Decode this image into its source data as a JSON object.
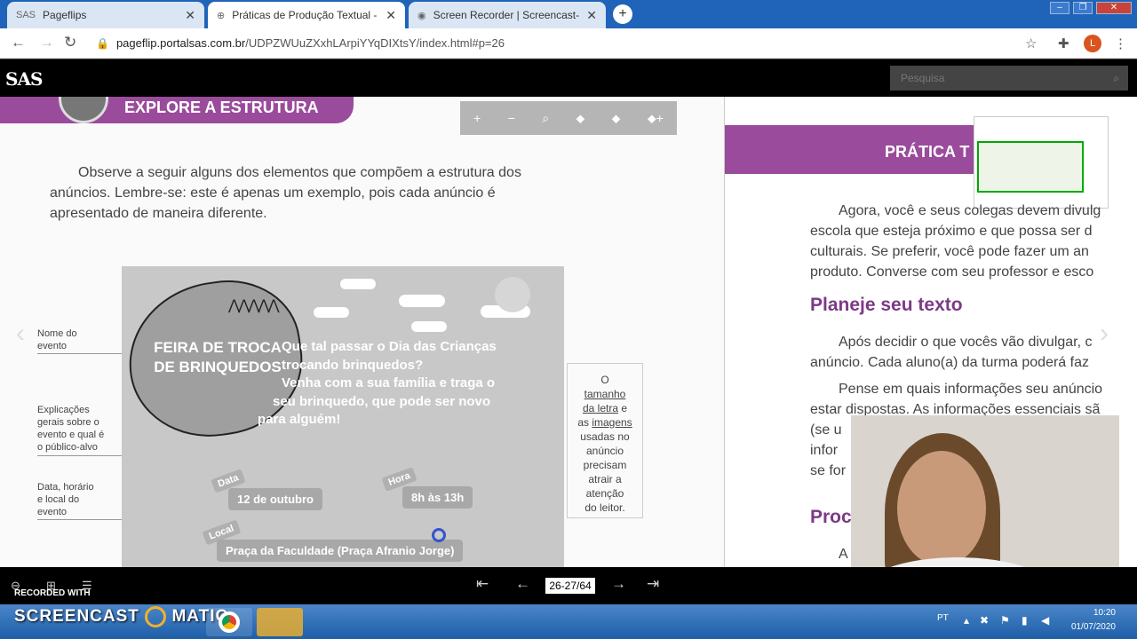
{
  "browser": {
    "tabs": [
      {
        "icon": "SAS",
        "title": "Pageflips",
        "active": false
      },
      {
        "icon": "⊕",
        "title": "Práticas de Produção Textual - Li",
        "active": true
      },
      {
        "icon": "◉",
        "title": "Screen Recorder | Screencast-O-M",
        "active": false
      }
    ],
    "new_tab": "+",
    "url_host": "pageflip.portalsas.com.br",
    "url_path": "/UDPZWUuZXxhLArpiYYqDIXtsY/index.html#p=26",
    "profile_initial": "L"
  },
  "viewer": {
    "logo": "SAS",
    "search_placeholder": "Pesquisa",
    "zoom_buttons": [
      "+",
      "−",
      "⌕",
      "⬥",
      "⬥",
      "⬥+"
    ],
    "page_indicator": "26-27/64"
  },
  "left_page": {
    "banner": "EXPLORE A ESTRUTURA",
    "intro": [
      "Observe a seguir alguns dos elementos que compõem a estrutura dos",
      "anúncios. Lembre-se: este é apenas um exemplo, pois cada anúncio é",
      "apresentado de maneira diferente."
    ],
    "labels": {
      "event_name": [
        "Nome do",
        "evento"
      ],
      "explanations": [
        "Explicações",
        "gerais sobre o",
        "evento e qual é",
        "o público-alvo"
      ],
      "datetime": [
        "Data, horário",
        "e local do",
        "evento"
      ]
    },
    "ad": {
      "title": [
        "FEIRA DE TROCA",
        "DE BRINQUEDOS"
      ],
      "main": [
        "Que tal passar o Dia das Crianças",
        "trocando brinquedos?",
        "Venha com a sua família e traga o",
        "seu brinquedo, que pode ser novo",
        "para alguém!"
      ],
      "date_tag": "Data",
      "date": "12 de outubro",
      "time_tag": "Hora",
      "time": "8h às 13h",
      "place_tag": "Local",
      "place": "Praça da Faculdade (Praça Afranio Jorge)"
    },
    "note": {
      "line1": "O",
      "line2": "tamanho",
      "line3a": "da letra",
      "line3b": " e",
      "line4a": "as ",
      "line4b": "imagens",
      "rest": [
        "usadas no",
        "anúncio",
        "precisam",
        "atrair a",
        "atenção",
        "do leitor."
      ]
    }
  },
  "right_page": {
    "banner": "PRÁTICA T",
    "para1": [
      "Agora, você e seus colegas devem divulg",
      "escola que esteja próximo e que possa ser d",
      "culturais. Se preferir, você pode fazer um an",
      "produto. Converse com seu professor e esco"
    ],
    "heading1": "Planeje seu texto",
    "para2": [
      "Após decidir o que vocês vão divulgar, c",
      "anúncio. Cada aluno(a) da turma poderá faz"
    ],
    "para3": [
      "Pense em quais informações seu anúncio",
      "estar dispostas. As informações essenciais sã",
      "(se u",
      "infor",
      "se for"
    ],
    "heading2": "Proc",
    "last": "A"
  },
  "recorder": {
    "brand": "SCREENCAST",
    "brand2": "MATIC",
    "recorded_with": "RECORDED WITH"
  },
  "taskbar": {
    "lang": "PT",
    "time": "10:20",
    "date": "01/07/2020"
  }
}
